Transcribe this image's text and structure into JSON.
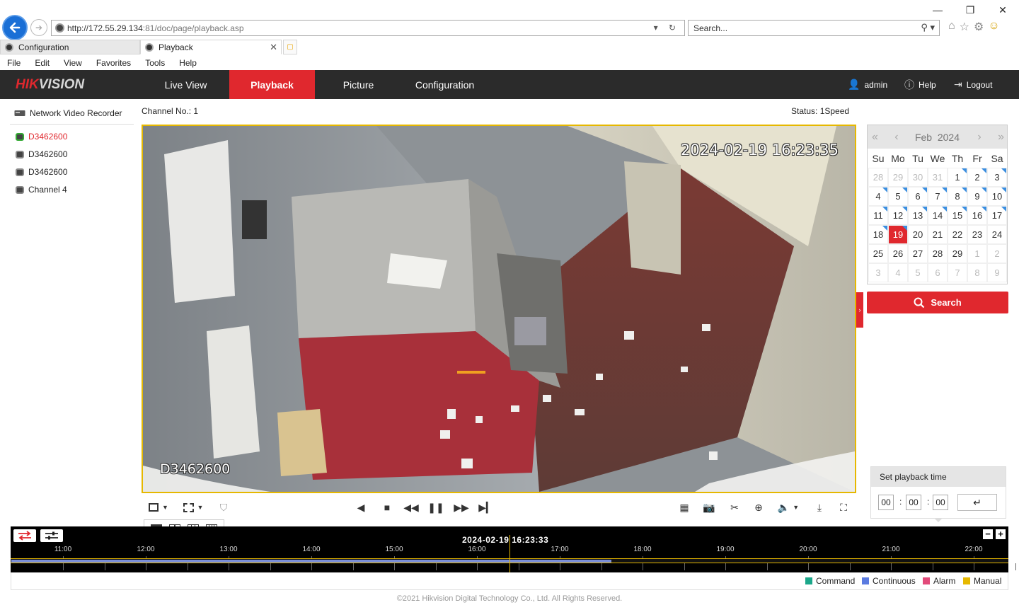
{
  "browser": {
    "url_host": "http://172.55.29.134",
    "url_rest": ":81/doc/page/playback.asp",
    "search_placeholder": "Search...",
    "tabs": [
      {
        "label": "Configuration",
        "active": false
      },
      {
        "label": "Playback",
        "active": true
      }
    ],
    "menu": [
      "File",
      "Edit",
      "View",
      "Favorites",
      "Tools",
      "Help"
    ]
  },
  "app": {
    "logo_hik": "HIK",
    "logo_vision": "VISION",
    "nav": [
      "Live View",
      "Playback",
      "Picture",
      "Configuration"
    ],
    "active_nav": "Playback",
    "user": "admin",
    "help": "Help",
    "logout": "Logout",
    "accent_color": "#e0282e"
  },
  "device_tree": {
    "root": "Network Video Recorder",
    "channels": [
      {
        "label": "D3462600",
        "selected": true
      },
      {
        "label": "D3462600",
        "selected": false
      },
      {
        "label": "D3462600",
        "selected": false
      },
      {
        "label": "Channel 4",
        "selected": false
      }
    ]
  },
  "player": {
    "channel_label": "Channel No.: 1",
    "status_label": "Status: 1Speed",
    "osd_time": "2024-02-19 16:23:35",
    "osd_name": "D3462600"
  },
  "calendar": {
    "month": "Feb",
    "year": "2024",
    "weekdays": [
      "Su",
      "Mo",
      "Tu",
      "We",
      "Th",
      "Fr",
      "Sa"
    ],
    "days": [
      {
        "d": "28",
        "other": true,
        "rec": false
      },
      {
        "d": "29",
        "other": true,
        "rec": false
      },
      {
        "d": "30",
        "other": true,
        "rec": false
      },
      {
        "d": "31",
        "other": true,
        "rec": false
      },
      {
        "d": "1",
        "other": false,
        "rec": true
      },
      {
        "d": "2",
        "other": false,
        "rec": true
      },
      {
        "d": "3",
        "other": false,
        "rec": true
      },
      {
        "d": "4",
        "other": false,
        "rec": true
      },
      {
        "d": "5",
        "other": false,
        "rec": true
      },
      {
        "d": "6",
        "other": false,
        "rec": true
      },
      {
        "d": "7",
        "other": false,
        "rec": true
      },
      {
        "d": "8",
        "other": false,
        "rec": true
      },
      {
        "d": "9",
        "other": false,
        "rec": true
      },
      {
        "d": "10",
        "other": false,
        "rec": true
      },
      {
        "d": "11",
        "other": false,
        "rec": true
      },
      {
        "d": "12",
        "other": false,
        "rec": true
      },
      {
        "d": "13",
        "other": false,
        "rec": true
      },
      {
        "d": "14",
        "other": false,
        "rec": true
      },
      {
        "d": "15",
        "other": false,
        "rec": true
      },
      {
        "d": "16",
        "other": false,
        "rec": true
      },
      {
        "d": "17",
        "other": false,
        "rec": true
      },
      {
        "d": "18",
        "other": false,
        "rec": true
      },
      {
        "d": "19",
        "other": false,
        "rec": true,
        "selected": true
      },
      {
        "d": "20",
        "other": false,
        "rec": false
      },
      {
        "d": "21",
        "other": false,
        "rec": false
      },
      {
        "d": "22",
        "other": false,
        "rec": false
      },
      {
        "d": "23",
        "other": false,
        "rec": false
      },
      {
        "d": "24",
        "other": false,
        "rec": false
      },
      {
        "d": "25",
        "other": false,
        "rec": false
      },
      {
        "d": "26",
        "other": false,
        "rec": false
      },
      {
        "d": "27",
        "other": false,
        "rec": false
      },
      {
        "d": "28",
        "other": false,
        "rec": false
      },
      {
        "d": "29",
        "other": false,
        "rec": false
      },
      {
        "d": "1",
        "other": true,
        "rec": false
      },
      {
        "d": "2",
        "other": true,
        "rec": false
      },
      {
        "d": "3",
        "other": true,
        "rec": false
      },
      {
        "d": "4",
        "other": true,
        "rec": false
      },
      {
        "d": "5",
        "other": true,
        "rec": false
      },
      {
        "d": "6",
        "other": true,
        "rec": false
      },
      {
        "d": "7",
        "other": true,
        "rec": false
      },
      {
        "d": "8",
        "other": true,
        "rec": false
      },
      {
        "d": "9",
        "other": true,
        "rec": false
      }
    ],
    "search_label": "Search"
  },
  "playback_time": {
    "title": "Set playback time",
    "hh": "00",
    "mm": "00",
    "ss": "00"
  },
  "timeline": {
    "current": "2024-02-19 16:23:33",
    "ticks": [
      "11:00",
      "12:00",
      "13:00",
      "14:00",
      "15:00",
      "16:00",
      "17:00",
      "18:00",
      "19:00",
      "20:00",
      "21:00",
      "22:00"
    ],
    "first_tick_hour": 11,
    "cursor_hour": 16.392,
    "recorded_until_hour": 17.627,
    "record_color": "#7a8ed6"
  },
  "legend": [
    {
      "label": "Command",
      "color": "#1ba78a"
    },
    {
      "label": "Continuous",
      "color": "#5b7be0"
    },
    {
      "label": "Alarm",
      "color": "#e24a7a"
    },
    {
      "label": "Manual",
      "color": "#e6b800"
    }
  ],
  "footer": "©2021 Hikvision Digital Technology Co., Ltd. All Rights Reserved."
}
